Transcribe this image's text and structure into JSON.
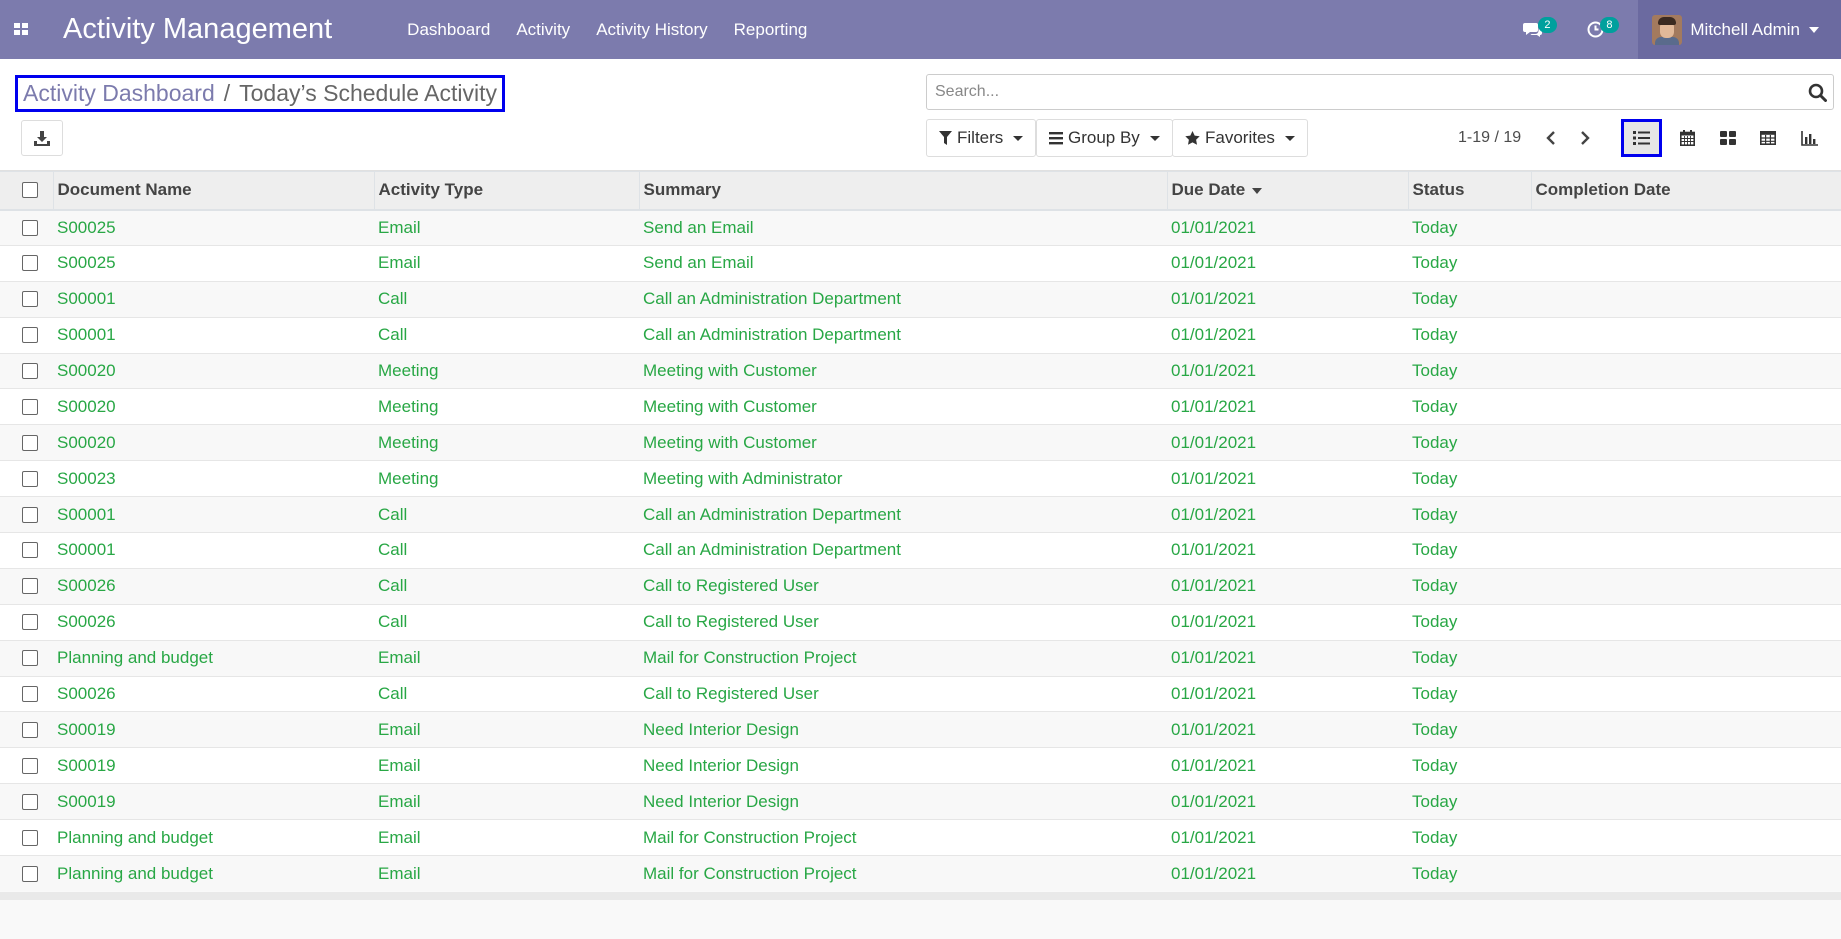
{
  "navbar": {
    "app_title": "Activity Management",
    "menu": [
      "Dashboard",
      "Activity",
      "Activity History",
      "Reporting"
    ],
    "messages_count": "2",
    "activities_count": "8",
    "user_name": "Mitchell Admin"
  },
  "breadcrumb": {
    "parent": "Activity Dashboard",
    "separator": "/",
    "current": "Today’s Schedule Activity"
  },
  "search": {
    "placeholder": "Search..."
  },
  "filters": {
    "filters_label": "Filters",
    "group_by_label": "Group By",
    "favorites_label": "Favorites"
  },
  "pager": {
    "value": "1-19 / 19"
  },
  "colors": {
    "navbar": "#7c7bad",
    "text_green": "#28a745",
    "badge": "#00a09d",
    "highlight": "#0000ee"
  },
  "table": {
    "columns": [
      "Document Name",
      "Activity Type",
      "Summary",
      "Due Date",
      "Status",
      "Completion Date"
    ],
    "rows": [
      [
        "S00025",
        "Email",
        "Send an Email",
        "01/01/2021",
        "Today",
        ""
      ],
      [
        "S00025",
        "Email",
        "Send an Email",
        "01/01/2021",
        "Today",
        ""
      ],
      [
        "S00001",
        "Call",
        "Call an Administration Department",
        "01/01/2021",
        "Today",
        ""
      ],
      [
        "S00001",
        "Call",
        "Call an Administration Department",
        "01/01/2021",
        "Today",
        ""
      ],
      [
        "S00020",
        "Meeting",
        "Meeting with Customer",
        "01/01/2021",
        "Today",
        ""
      ],
      [
        "S00020",
        "Meeting",
        "Meeting with Customer",
        "01/01/2021",
        "Today",
        ""
      ],
      [
        "S00020",
        "Meeting",
        "Meeting with Customer",
        "01/01/2021",
        "Today",
        ""
      ],
      [
        "S00023",
        "Meeting",
        "Meeting with Administrator",
        "01/01/2021",
        "Today",
        ""
      ],
      [
        "S00001",
        "Call",
        "Call an Administration Department",
        "01/01/2021",
        "Today",
        ""
      ],
      [
        "S00001",
        "Call",
        "Call an Administration Department",
        "01/01/2021",
        "Today",
        ""
      ],
      [
        "S00026",
        "Call",
        "Call to Registered User",
        "01/01/2021",
        "Today",
        ""
      ],
      [
        "S00026",
        "Call",
        "Call to Registered User",
        "01/01/2021",
        "Today",
        ""
      ],
      [
        "Planning and budget",
        "Email",
        "Mail for Construction Project",
        "01/01/2021",
        "Today",
        ""
      ],
      [
        "S00026",
        "Call",
        "Call to Registered User",
        "01/01/2021",
        "Today",
        ""
      ],
      [
        "S00019",
        "Email",
        "Need Interior Design",
        "01/01/2021",
        "Today",
        ""
      ],
      [
        "S00019",
        "Email",
        "Need Interior Design",
        "01/01/2021",
        "Today",
        ""
      ],
      [
        "S00019",
        "Email",
        "Need Interior Design",
        "01/01/2021",
        "Today",
        ""
      ],
      [
        "Planning and budget",
        "Email",
        "Mail for Construction Project",
        "01/01/2021",
        "Today",
        ""
      ],
      [
        "Planning and budget",
        "Email",
        "Mail for Construction Project",
        "01/01/2021",
        "Today",
        ""
      ]
    ]
  }
}
